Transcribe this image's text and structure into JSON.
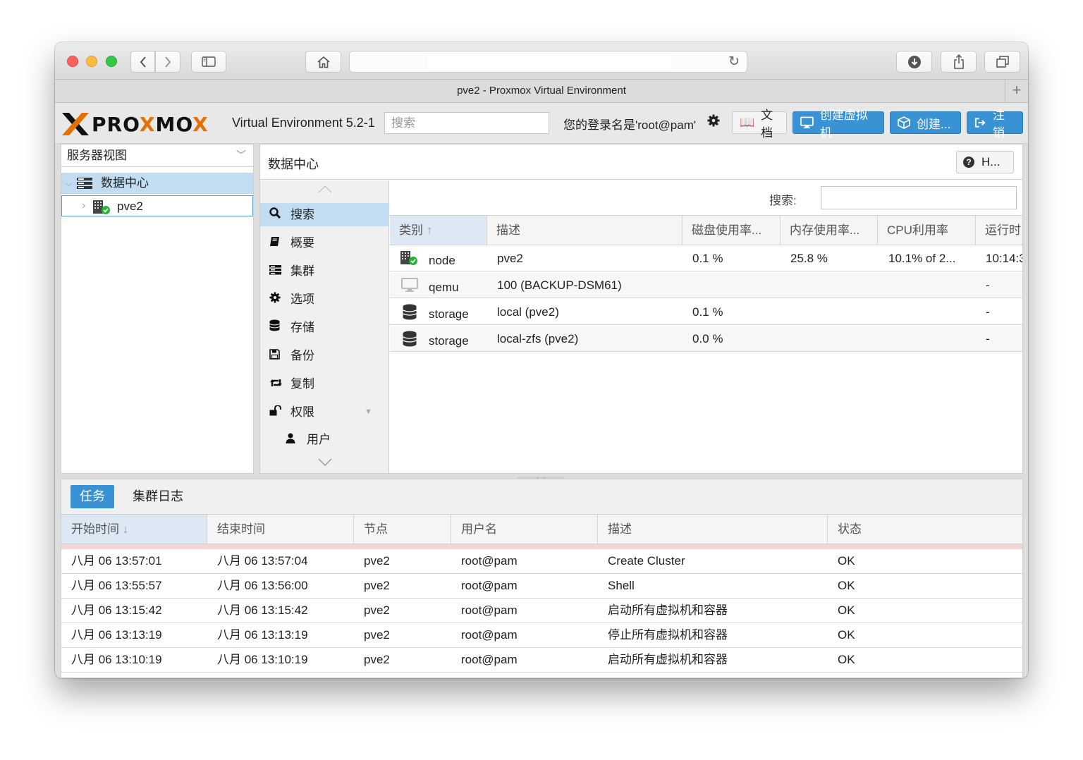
{
  "browser": {
    "tab_title": "pve2 - Proxmox Virtual Environment",
    "new_tab": "+"
  },
  "header": {
    "logo_text_1": "PRO",
    "logo_text_x": "X",
    "logo_text_2": "MO",
    "logo_text_x2": "X",
    "version": "Virtual Environment 5.2-1",
    "search_placeholder": "搜索",
    "login_text": "您的登录名是'root@pam'",
    "btn_docs": "文档",
    "btn_create_vm": "创建虚拟机",
    "btn_create_ct": "创建...",
    "btn_logout": "注销"
  },
  "tree": {
    "view_selector": "服务器视图",
    "datacenter": "数据中心",
    "node": "pve2"
  },
  "content": {
    "title": "数据中心",
    "help_btn": "H...",
    "nav": [
      {
        "label": "搜索",
        "icon": "search-icon"
      },
      {
        "label": "概要",
        "icon": "book-icon"
      },
      {
        "label": "集群",
        "icon": "server-icon"
      },
      {
        "label": "选项",
        "icon": "gear-icon"
      },
      {
        "label": "存储",
        "icon": "database-icon"
      },
      {
        "label": "备份",
        "icon": "floppy-icon"
      },
      {
        "label": "复制",
        "icon": "retweet-icon"
      },
      {
        "label": "权限",
        "icon": "unlock-icon"
      },
      {
        "label": "用户",
        "icon": "user-icon"
      }
    ],
    "search_label": "搜索:",
    "columns": [
      "类别",
      "描述",
      "磁盘使用率...",
      "内存使用率...",
      "CPU利用率",
      "运行时"
    ],
    "rows": [
      {
        "type": "node",
        "desc": "pve2",
        "disk": "0.1 %",
        "mem": "25.8 %",
        "cpu": "10.1% of 2...",
        "uptime": "10:14:3"
      },
      {
        "type": "qemu",
        "desc": "100 (BACKUP-DSM61)",
        "disk": "",
        "mem": "",
        "cpu": "",
        "uptime": "-"
      },
      {
        "type": "storage",
        "desc": "local (pve2)",
        "disk": "0.1 %",
        "mem": "",
        "cpu": "",
        "uptime": "-"
      },
      {
        "type": "storage",
        "desc": "local-zfs (pve2)",
        "disk": "0.0 %",
        "mem": "",
        "cpu": "",
        "uptime": "-"
      }
    ]
  },
  "bottom": {
    "tab_tasks": "任务",
    "tab_cluster_log": "集群日志",
    "columns": [
      "开始时间",
      "结束时间",
      "节点",
      "用户名",
      "描述",
      "状态"
    ],
    "rows": [
      {
        "start": "八月 06 13:57:01",
        "end": "八月 06 13:57:04",
        "node": "pve2",
        "user": "root@pam",
        "desc": "Create Cluster",
        "status": "OK"
      },
      {
        "start": "八月 06 13:55:57",
        "end": "八月 06 13:56:00",
        "node": "pve2",
        "user": "root@pam",
        "desc": "Shell",
        "status": "OK"
      },
      {
        "start": "八月 06 13:15:42",
        "end": "八月 06 13:15:42",
        "node": "pve2",
        "user": "root@pam",
        "desc": "启动所有虚拟机和容器",
        "status": "OK"
      },
      {
        "start": "八月 06 13:13:19",
        "end": "八月 06 13:13:19",
        "node": "pve2",
        "user": "root@pam",
        "desc": "停止所有虚拟机和容器",
        "status": "OK"
      },
      {
        "start": "八月 06 13:10:19",
        "end": "八月 06 13:10:19",
        "node": "pve2",
        "user": "root@pam",
        "desc": "启动所有虚拟机和容器",
        "status": "OK"
      }
    ]
  },
  "colors": {
    "accent": "#3892d4",
    "selected_row": "#c2ddf2",
    "logo_orange": "#e57000",
    "status_ok_green": "#21b532"
  }
}
